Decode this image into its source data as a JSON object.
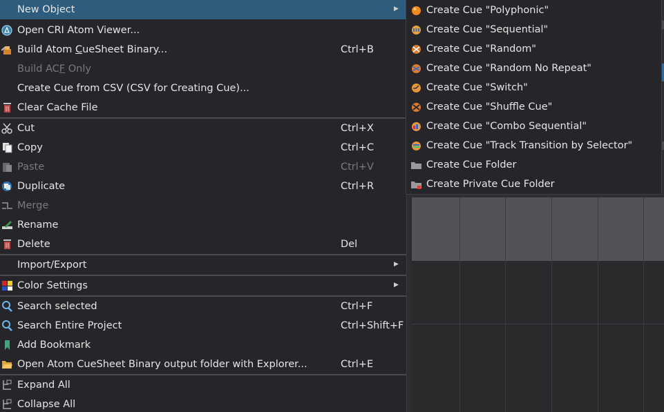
{
  "main_menu": {
    "new_object": {
      "label": "New Object",
      "icon": "new-object",
      "has_submenu": true
    },
    "open_viewer": {
      "label": "Open CRI Atom Viewer...",
      "icon": "atom-viewer-icon"
    },
    "build_binary": {
      "label_pre": "Build Atom ",
      "label_ul": "C",
      "label_post": "ueSheet Binary...",
      "shortcut": "Ctrl+B",
      "icon": "build-icon"
    },
    "build_acf": {
      "label_pre": "Build AC",
      "label_ul": "F",
      "label_post": " Only",
      "disabled": true
    },
    "create_csv": {
      "label": "Create Cue from CSV (CSV for Creating Cue)..."
    },
    "clear_cache": {
      "label": "Clear Cache File",
      "icon": "trash-icon"
    },
    "cut": {
      "label": "Cut",
      "shortcut": "Ctrl+X",
      "icon": "scissors-icon"
    },
    "copy": {
      "label": "Copy",
      "shortcut": "Ctrl+C",
      "icon": "copy-icon"
    },
    "paste": {
      "label": "Paste",
      "shortcut": "Ctrl+V",
      "icon": "paste-icon",
      "disabled": true
    },
    "duplicate": {
      "label": "Duplicate",
      "shortcut": "Ctrl+R",
      "icon": "duplicate-icon"
    },
    "merge": {
      "label": "Merge",
      "icon": "merge-icon",
      "disabled": true
    },
    "rename": {
      "label": "Rename",
      "icon": "rename-icon"
    },
    "delete": {
      "label": "Delete",
      "shortcut": "Del",
      "icon": "trash-icon"
    },
    "import_export": {
      "label": "Import/Export",
      "has_submenu": true
    },
    "color_settings": {
      "label": "Color Settings",
      "icon": "color-palette-icon",
      "has_submenu": true
    },
    "search_selected": {
      "label": "Search selected",
      "shortcut": "Ctrl+F",
      "icon": "search-icon"
    },
    "search_project": {
      "label": "Search Entire Project",
      "shortcut": "Ctrl+Shift+F",
      "icon": "search-icon"
    },
    "add_bookmark": {
      "label": "Add Bookmark",
      "icon": "bookmark-icon"
    },
    "open_output": {
      "label": "Open Atom CueSheet Binary output folder with Explorer...",
      "shortcut": "Ctrl+E",
      "icon": "folder-open-icon"
    },
    "expand_all": {
      "label": "Expand All",
      "icon": "expand-tree-icon"
    },
    "collapse_all": {
      "label": "Collapse All",
      "icon": "collapse-tree-icon"
    }
  },
  "submenu": {
    "items": [
      {
        "label": "Create Cue \"Polyphonic\"",
        "icon": "cue-polyphonic-icon",
        "color": "#f08a1c"
      },
      {
        "label": "Create Cue \"Sequential\"",
        "icon": "cue-sequential-icon",
        "color": "#e8a33a"
      },
      {
        "label": "Create Cue \"Random\"",
        "icon": "cue-random-icon",
        "color": "#e07b2a"
      },
      {
        "label": "Create Cue \"Random No Repeat\"",
        "icon": "cue-random-no-repeat-icon",
        "color": "#e07b2a"
      },
      {
        "label": "Create Cue \"Switch\"",
        "icon": "cue-switch-icon",
        "color": "#e8953a"
      },
      {
        "label": "Create Cue \"Shuffle Cue\"",
        "icon": "cue-shuffle-icon",
        "color": "#e07b2a"
      },
      {
        "label": "Create Cue \"Combo Sequential\"",
        "icon": "cue-combo-sequential-icon",
        "color": "#e8953a"
      },
      {
        "label": "Create Cue \"Track Transition by Selector\"",
        "icon": "cue-track-transition-icon",
        "color": "#e8953a"
      },
      {
        "label": "Create Cue Folder",
        "icon": "folder-icon",
        "color": "#9a9a9a"
      },
      {
        "label": "Create Private Cue Folder",
        "icon": "private-folder-icon",
        "color": "#9a9a9a"
      }
    ]
  },
  "colors": {
    "menu_bg": "#26262a",
    "highlight": "#2d5c7c",
    "text": "#e6e6e6",
    "disabled_text": "#7a7a7e",
    "separator": "#4a4a4f"
  }
}
